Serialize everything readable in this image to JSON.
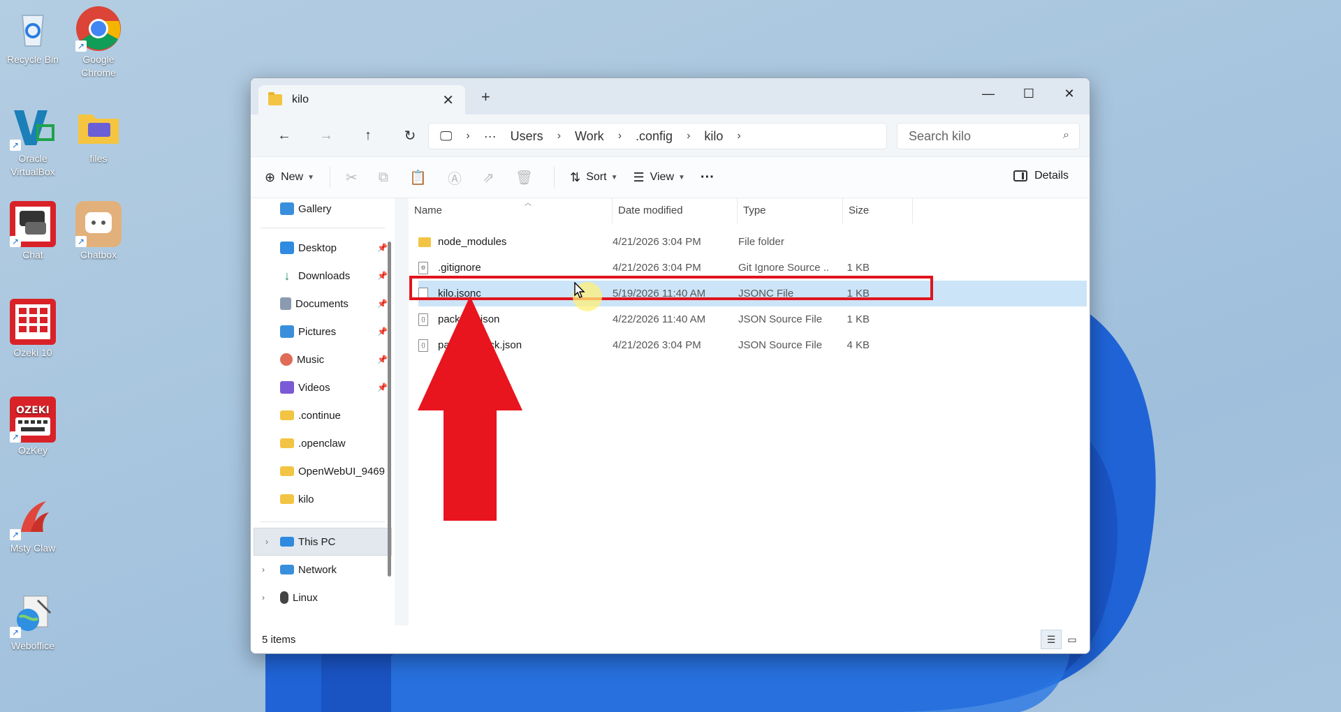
{
  "desktop": {
    "icons": [
      {
        "label": "Recycle Bin"
      },
      {
        "label": "Google Chrome"
      },
      {
        "label": "Oracle VirtualBox"
      },
      {
        "label": "files"
      },
      {
        "label": "Chat"
      },
      {
        "label": "Chatbox"
      },
      {
        "label": "Ozeki 10"
      },
      {
        "label": "OzKey"
      },
      {
        "label": "Msty Claw"
      },
      {
        "label": "Weboffice"
      }
    ]
  },
  "window": {
    "tab_title": "kilo",
    "address": {
      "segments": [
        "Users",
        "Work",
        ".config",
        "kilo"
      ]
    },
    "search_placeholder": "Search kilo",
    "toolbar": {
      "new_label": "New",
      "sort_label": "Sort",
      "view_label": "View",
      "more_label": "···",
      "details_label": "Details"
    },
    "sidebar": {
      "gallery": "Gallery",
      "quick_access": [
        {
          "label": "Desktop"
        },
        {
          "label": "Downloads"
        },
        {
          "label": "Documents"
        },
        {
          "label": "Pictures"
        },
        {
          "label": "Music"
        },
        {
          "label": "Videos"
        },
        {
          "label": ".continue"
        },
        {
          "label": ".openclaw"
        },
        {
          "label": "OpenWebUI_9469"
        },
        {
          "label": "kilo"
        }
      ],
      "this_pc": "This PC",
      "network": "Network",
      "linux": "Linux"
    },
    "columns": {
      "name": "Name",
      "date": "Date modified",
      "type": "Type",
      "size": "Size"
    },
    "files": [
      {
        "name": "node_modules",
        "date": "4/21/2026 3:04 PM",
        "type": "File folder",
        "size": ""
      },
      {
        "name": ".gitignore",
        "date": "4/21/2026 3:04 PM",
        "type": "Git Ignore Source ...",
        "size": "1 KB"
      },
      {
        "name": "kilo.jsonc",
        "date": "5/19/2026 11:40 AM",
        "type": "JSONC File",
        "size": "1 KB"
      },
      {
        "name": "package.json",
        "date": "4/22/2026 11:40 AM",
        "type": "JSON Source File",
        "size": "1 KB"
      },
      {
        "name": "package-lock.json",
        "date": "4/21/2026 3:04 PM",
        "type": "JSON Source File",
        "size": "4 KB"
      }
    ],
    "status_text": "5 items"
  },
  "colors": {
    "highlight": "#e0141e",
    "selection": "#cce4f7"
  }
}
